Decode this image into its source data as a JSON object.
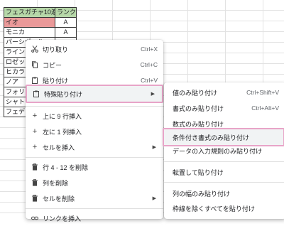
{
  "sheet": {
    "headers": [
      "フェスガチャ10連",
      "ランク"
    ],
    "rows": [
      {
        "name": "イオ",
        "rank": "A"
      },
      {
        "name": "モニカ",
        "rank": "A"
      },
      {
        "name": "パーシヴァル",
        "rank": ""
      },
      {
        "name": "ライン",
        "rank": ""
      },
      {
        "name": "ロゼッ",
        "rank": ""
      },
      {
        "name": "ヒカラ",
        "rank": ""
      },
      {
        "name": "ノア",
        "rank": ""
      },
      {
        "name": "フォリ",
        "rank": ""
      },
      {
        "name": "シャト",
        "rank": ""
      },
      {
        "name": "フェデ",
        "rank": ""
      }
    ]
  },
  "context_menu": {
    "cut": {
      "label": "切り取り",
      "shortcut": "Ctrl+X"
    },
    "copy": {
      "label": "コピー",
      "shortcut": "Ctrl+C"
    },
    "paste": {
      "label": "貼り付け",
      "shortcut": "Ctrl+V"
    },
    "paste_special": {
      "label": "特殊貼り付け"
    },
    "insert_rows_above": {
      "label": "上に 9 行挿入"
    },
    "insert_col_left": {
      "label": "左に 1 列挿入"
    },
    "insert_cells": {
      "label": "セルを挿入"
    },
    "delete_rows": {
      "label": "行 4 - 12 を削除"
    },
    "delete_col": {
      "label": "列を削除"
    },
    "delete_cells": {
      "label": "セルを削除"
    },
    "insert_link": {
      "label": "リンクを挿入"
    }
  },
  "paste_special_menu": {
    "values_only": {
      "label": "値のみ貼り付け",
      "shortcut": "Ctrl+Shift+V"
    },
    "format_only": {
      "label": "書式のみ貼り付け",
      "shortcut": "Ctrl+Alt+V"
    },
    "formula_only": {
      "label": "数式のみ貼り付け"
    },
    "conditional_format_only": {
      "label": "条件付き書式のみ貼り付け"
    },
    "data_validation_only": {
      "label": "データの入力規則のみ貼り付け"
    },
    "transpose": {
      "label": "転置して貼り付け"
    },
    "column_width_only": {
      "label": "列の幅のみ貼り付け"
    },
    "all_except_borders": {
      "label": "枠線を除くすべてを貼り付け"
    }
  }
}
